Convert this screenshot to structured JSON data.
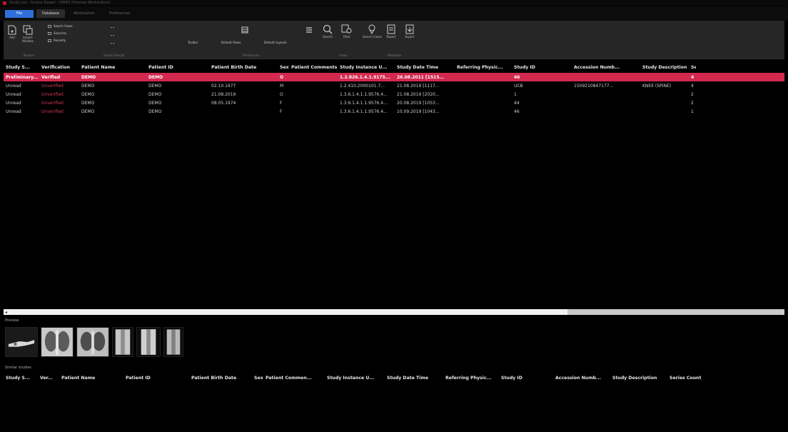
{
  "window": {
    "title": "Study List - Aurora Viewer - DEMO (Preview Workstation)"
  },
  "ribbon_tabs": {
    "file": "File",
    "tabs": [
      "Database",
      "Workstation",
      "Preferences"
    ]
  },
  "ribbon": {
    "import_label": "Add",
    "import_sub": "Import\nWindow",
    "small_group": [
      "Search Views",
      "Searches",
      "Recently"
    ],
    "group_labels": [
      "Browse",
      "Search Results",
      "Preferences",
      "Views",
      "Metadata"
    ],
    "toolbar_labels": [
      "Toolbar",
      "Default Views",
      "Default Layouts"
    ],
    "tools": [
      "Search",
      "Filter",
      "Search Cases",
      "Report",
      "Export"
    ]
  },
  "table": {
    "columns": [
      "Study S...",
      "Verification",
      "Patient Name",
      "Patient ID",
      "Patient Birth Date",
      "Sex",
      "Patient Comments...",
      "Study Instance U...",
      "Study Date Time",
      "Referring Physic...",
      "Study ID",
      "Accession Numb...",
      "Study Description",
      "Se"
    ],
    "rows": [
      [
        "Preliminary...",
        "Verified",
        "DEMO",
        "DEMO",
        "",
        "O",
        "",
        "1.2.826.1.4.1.9175...",
        "26.08.2011 [1515...",
        "",
        "46",
        "",
        "",
        "4"
      ],
      [
        "Unread",
        "Unverified",
        "DEMO",
        "DEMO",
        "02.10.1977",
        "M",
        "",
        "1.2.410.2000101.7...",
        "21.08.2019 [1117...",
        "",
        "UCB",
        "1509210847177...",
        "KNEE (SPINE)",
        "4"
      ],
      [
        "Unread",
        "Unverified",
        "DEMO",
        "DEMO",
        "21.08.2019",
        "O",
        "",
        "1.3.6.1.4.1.1.9576.4...",
        "21.08.2019 [2020...",
        "",
        "1",
        "",
        "",
        "2"
      ],
      [
        "Unread",
        "Unverified",
        "DEMO",
        "DEMO",
        "08.05.1974",
        "F",
        "",
        "1.3.6.1.4.1.1.9576.4...",
        "20.08.2019 [1053...",
        "",
        "44",
        "",
        "",
        "2"
      ],
      [
        "Unread",
        "Unverified",
        "DEMO",
        "DEMO",
        "",
        "F",
        "",
        "1.3.6.1.4.1.1.9576.4...",
        "10.09.2019 [1043...",
        "",
        "46",
        "",
        "",
        "1"
      ]
    ]
  },
  "preview": {
    "label": "Preview",
    "thumbnails": [
      "series-hand",
      "series-chest-1",
      "series-chest-2",
      "series-spine-1",
      "series-spine-2",
      "series-spine-3"
    ]
  },
  "bottom_table": {
    "label": "Similar studies",
    "columns": [
      "Study S...",
      "Ver...",
      "Patient Name",
      "Patient ID",
      "Patient Birth Date",
      "Sex",
      "Patient Commen...",
      "Study Instance U...",
      "Study Date Time",
      "Referring Physic...",
      "Study ID",
      "Accession Numb...",
      "Study Description",
      "Series Count"
    ]
  },
  "colors": {
    "accent": "#2f6fdb",
    "selected_row": "#d3294f",
    "unverified_text": "#d03a55"
  }
}
